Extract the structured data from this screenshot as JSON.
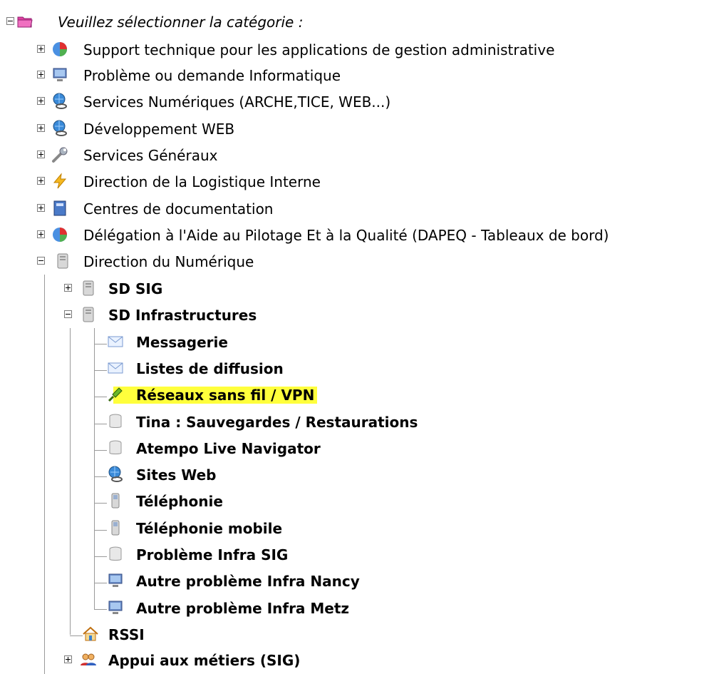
{
  "tree": {
    "root": {
      "label": "Veuillez sélectionner la catégorie :"
    },
    "categories": [
      {
        "label": "Support technique pour les applications de gestion administrative"
      },
      {
        "label": "Problème ou demande Informatique"
      },
      {
        "label": "Services Numériques (ARCHE,TICE, WEB...)"
      },
      {
        "label": "Développement WEB"
      },
      {
        "label": "Services Généraux"
      },
      {
        "label": "Direction de la Logistique Interne"
      },
      {
        "label": "Centres de documentation"
      },
      {
        "label": "Délégation à l'Aide au Pilotage Et à la Qualité (DAPEQ - Tableaux de bord)"
      },
      {
        "label": "Direction du Numérique"
      }
    ],
    "numerique": {
      "sd_sig": "SD SIG",
      "sd_infra": "SD Infrastructures",
      "infra_items": [
        {
          "label": "Messagerie"
        },
        {
          "label": "Listes de diffusion"
        },
        {
          "label": "Réseaux sans fil / VPN"
        },
        {
          "label": "Tina : Sauvegardes / Restaurations"
        },
        {
          "label": "Atempo Live Navigator"
        },
        {
          "label": "Sites Web"
        },
        {
          "label": "Téléphonie"
        },
        {
          "label": "Téléphonie mobile"
        },
        {
          "label": "Problème Infra SIG"
        },
        {
          "label": "Autre problème Infra Nancy"
        },
        {
          "label": "Autre problème Infra Metz"
        }
      ],
      "rssi": "RSSI",
      "appui": "Appui aux métiers (SIG)"
    }
  },
  "colors": {
    "highlight": "#ffff3c",
    "tree_line": "#9a9a9a"
  }
}
